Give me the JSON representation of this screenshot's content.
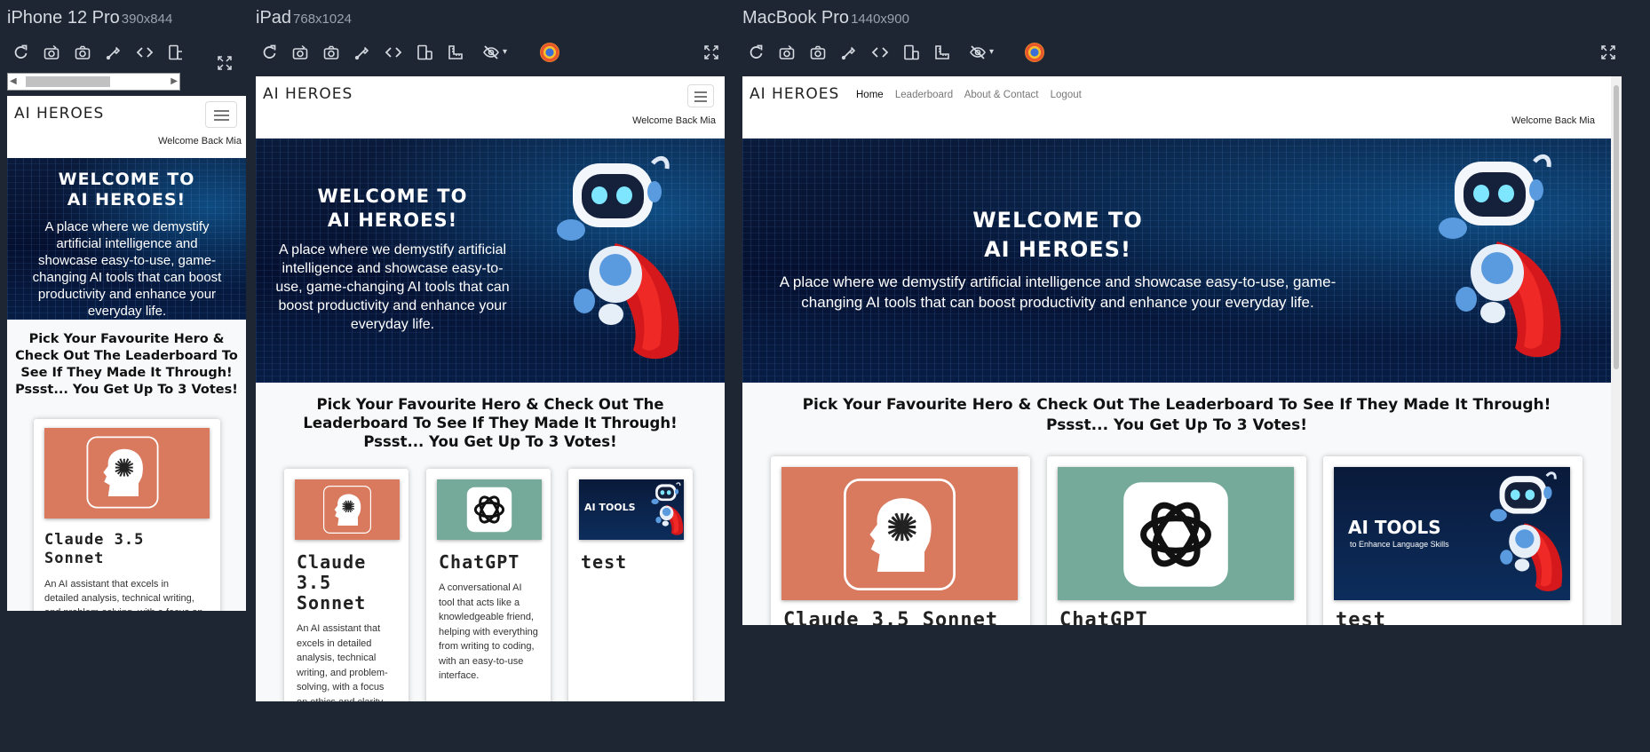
{
  "devices": {
    "iphone": {
      "name": "iPhone 12 Pro",
      "dims": "390x844"
    },
    "ipad": {
      "name": "iPad",
      "dims": "768x1024"
    },
    "macbook": {
      "name": "MacBook Pro",
      "dims": "1440x900"
    }
  },
  "site": {
    "logo": "AI HEROES",
    "welcome": "Welcome Back Mia",
    "nav": [
      "Home",
      "Leaderboard",
      "About & Contact",
      "Logout"
    ],
    "hero_title_line1": "WELCOME TO",
    "hero_title_line2": "AI HEROES!",
    "hero_desc": "A place where we demystify artificial intelligence and showcase easy-to-use, game-changing AI tools that can boost productivity and enhance your everyday life.",
    "pick_line1": "Pick Your Favourite Hero & Check Out The Leaderboard To See If They Made It Through!",
    "pick_line2": "Pssst... You Get Up To 3 Votes!",
    "cards": [
      {
        "title": "Claude 3.5 Sonnet",
        "desc": "An AI assistant that excels in detailed analysis, technical writing, and problem-solving, with a focus on ethics and clarity"
      },
      {
        "title": "ChatGPT",
        "desc": "A conversational AI tool that acts like a knowledgeable friend, helping with everything from writing to coding, with an easy-to-use interface."
      },
      {
        "title": "test",
        "desc": ""
      }
    ],
    "aitools_title": "AI TOOLS",
    "aitools_sub": "to Enhance Language Skills"
  },
  "colors": {
    "claude_bg": "#d97a5e",
    "chatgpt_bg": "#75a99a",
    "app_bg": "#1e2533"
  },
  "icons": [
    "refresh-icon",
    "camera-rotate-icon",
    "camera-icon",
    "eyedropper-icon",
    "code-icon",
    "responsive-icon",
    "ruler-icon",
    "eye-off-icon",
    "firefox-icon",
    "fullscreen-icon"
  ]
}
